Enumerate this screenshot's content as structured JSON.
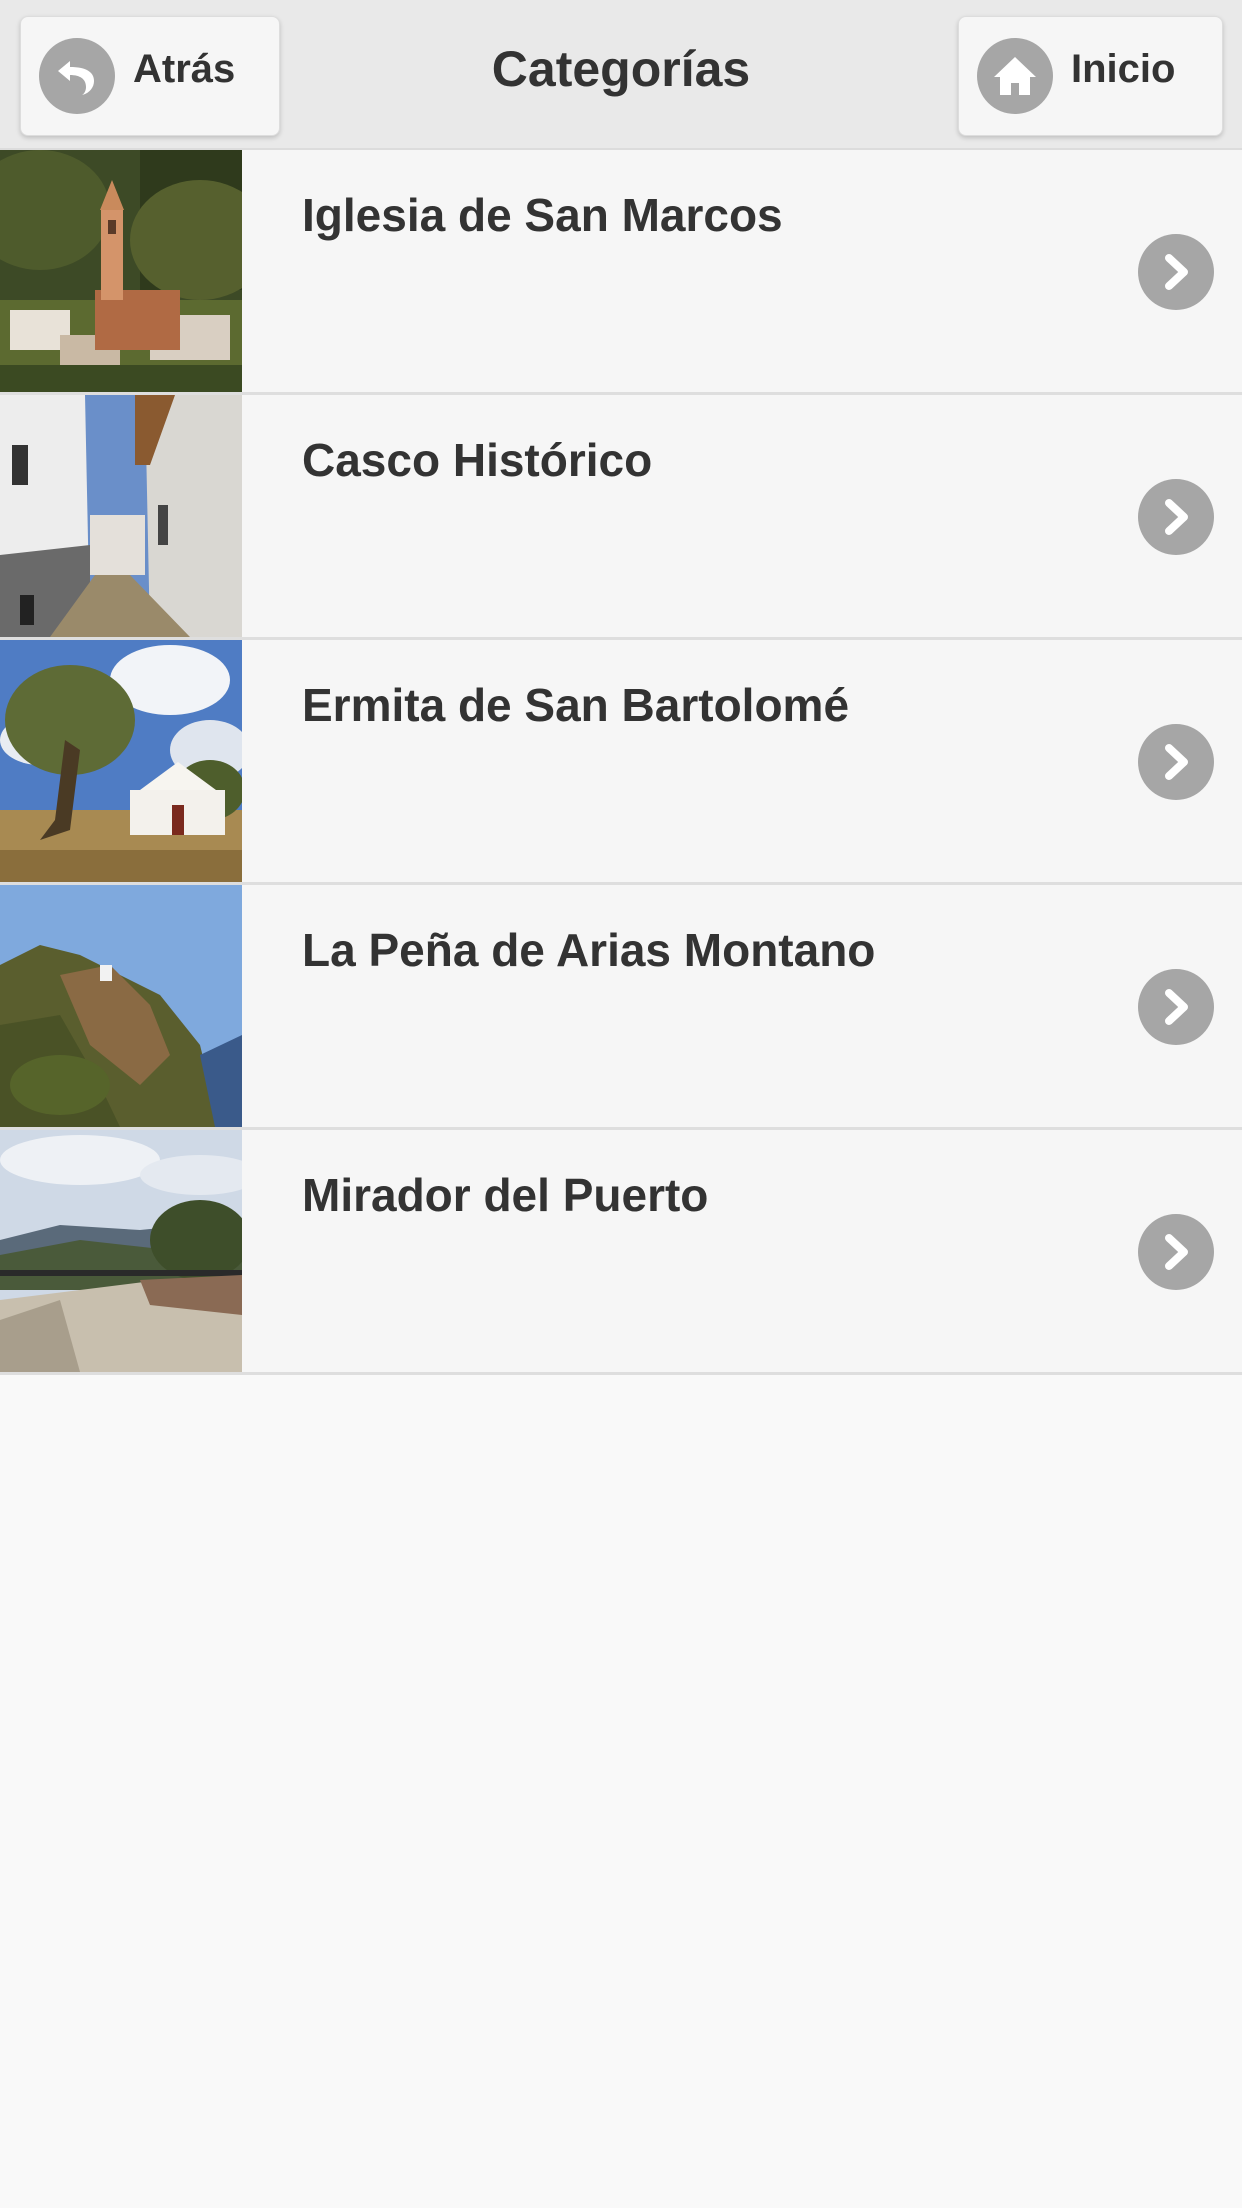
{
  "header": {
    "title": "Categorías",
    "back_label": "Atrás",
    "home_label": "Inicio"
  },
  "items": [
    {
      "label": "Iglesia de San Marcos"
    },
    {
      "label": "Casco Histórico"
    },
    {
      "label": "Ermita de San Bartolomé"
    },
    {
      "label": "La Peña de Arias Montano"
    },
    {
      "label": "Mirador del Puerto"
    }
  ],
  "icons": {
    "back": "back-arrow-icon",
    "home": "home-icon",
    "chevron": "chevron-right-icon"
  },
  "colors": {
    "header_bg": "#e9e9e9",
    "list_bg": "#f6f6f6",
    "icon_disc": "#a6a6a6",
    "text": "#333333"
  }
}
